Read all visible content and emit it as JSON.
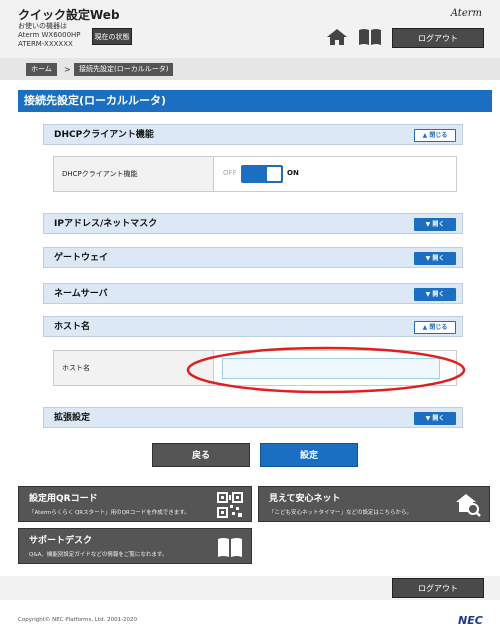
{
  "header": {
    "app_title": "クイック設定Web",
    "device_line1": "お使いの機器は",
    "device_line2": "Aterm WX6000HP",
    "device_line3": "ATERM-XXXXXX",
    "status_button": "現在の状態",
    "brand": "Aterm",
    "home_icon": "home-icon",
    "manual_icon": "book-icon",
    "logout": "ログアウト"
  },
  "breadcrumb": {
    "home": "ホーム",
    "separator": ">",
    "current": "接続先設定(ローカルルータ)"
  },
  "page_title": "接続先設定(ローカルルータ)",
  "sections": {
    "dhcp": {
      "title": "DHCPクライアント機能",
      "button": "閉じる"
    },
    "dhcp_row": {
      "label": "DHCPクライアント機能",
      "off": "OFF",
      "on": "ON",
      "value": "ON"
    },
    "ip": {
      "title": "IPアドレス/ネットマスク",
      "button": "開く"
    },
    "gateway": {
      "title": "ゲートウェイ",
      "button": "開く"
    },
    "nameserver": {
      "title": "ネームサーバ",
      "button": "開く"
    },
    "hostname": {
      "title": "ホスト名",
      "button": "閉じる"
    },
    "hostname_row": {
      "label": "ホスト名",
      "value": ""
    },
    "advanced": {
      "title": "拡張設定",
      "button": "開く"
    }
  },
  "actions": {
    "back": "戻る",
    "set": "設定"
  },
  "cards": {
    "qr": {
      "title": "設定用QRコード",
      "desc": "「Atermらくらく QRスタート」用のQRコードを作成できます。"
    },
    "safe": {
      "title": "見えて安心ネット",
      "desc": "「こども安心ネットタイマー」などの設定はこちらから。"
    },
    "support": {
      "title": "サポートデスク",
      "desc": "Q&A、機能別設定ガイドなどの情報をご覧になれます。"
    }
  },
  "footer": {
    "logout": "ログアウト",
    "copyright": "Copyright© NEC Platforms, Ltd. 2001-2020",
    "logo": "NEC"
  },
  "colors": {
    "accent": "#1a6fc2",
    "section_bg": "#dce8f5",
    "highlight": "#e0201c"
  }
}
